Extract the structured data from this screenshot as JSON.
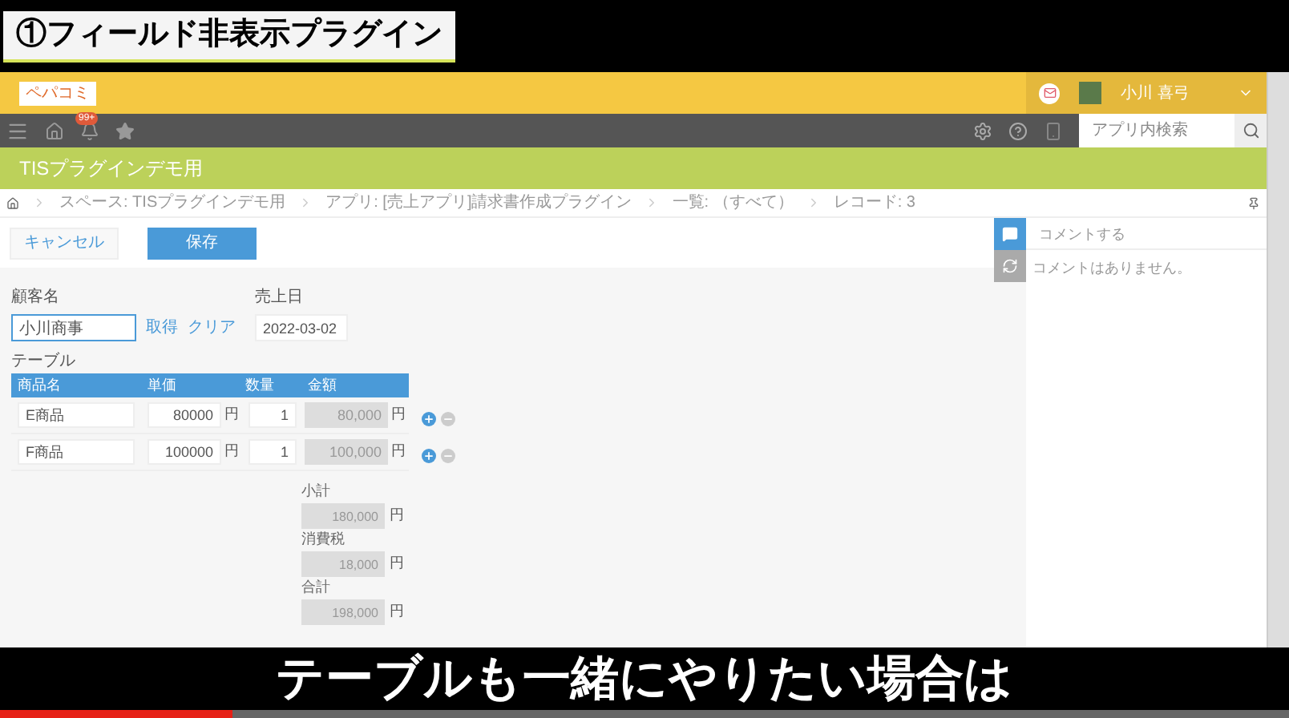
{
  "overlay_title": "①フィールド非表示プラグイン",
  "header": {
    "logo": "ペパコミ",
    "user_name": "小川 喜弓"
  },
  "nav": {
    "badge": "99+",
    "search_placeholder": "アプリ内検索"
  },
  "app_title": "TISプラグインデモ用",
  "breadcrumbs": [
    "スペース: TISプラグインデモ用",
    "アプリ: [売上アプリ]請求書作成プラグイン",
    "一覧: （すべて）",
    "レコード: 3"
  ],
  "buttons": {
    "cancel": "キャンセル",
    "save": "保存"
  },
  "customer": {
    "label": "顧客名",
    "value": "小川商事",
    "links": [
      "取得",
      "クリア"
    ]
  },
  "date": {
    "label": "売上日",
    "value": "2022-03-02"
  },
  "table": {
    "label": "テーブル",
    "columns": [
      "商品名",
      "単価",
      "数量",
      "金額"
    ],
    "rows": [
      {
        "product": "E商品",
        "price": "80000",
        "price_unit": "円",
        "qty": "1",
        "amount": "80,000",
        "amount_unit": "円"
      },
      {
        "product": "F商品",
        "price": "100000",
        "price_unit": "円",
        "qty": "1",
        "amount": "100,000",
        "amount_unit": "円"
      }
    ]
  },
  "totals": [
    {
      "label": "小計",
      "value": "180,000",
      "unit": "円"
    },
    {
      "label": "消費税",
      "value": "18,000",
      "unit": "円"
    },
    {
      "label": "合計",
      "value": "198,000",
      "unit": "円"
    }
  ],
  "comments": {
    "placeholder": "コメントする",
    "empty": "コメントはありません。"
  },
  "subtitle": "テーブルも一緒にやりたい場合は",
  "video_progress": {
    "level": 0.18
  }
}
